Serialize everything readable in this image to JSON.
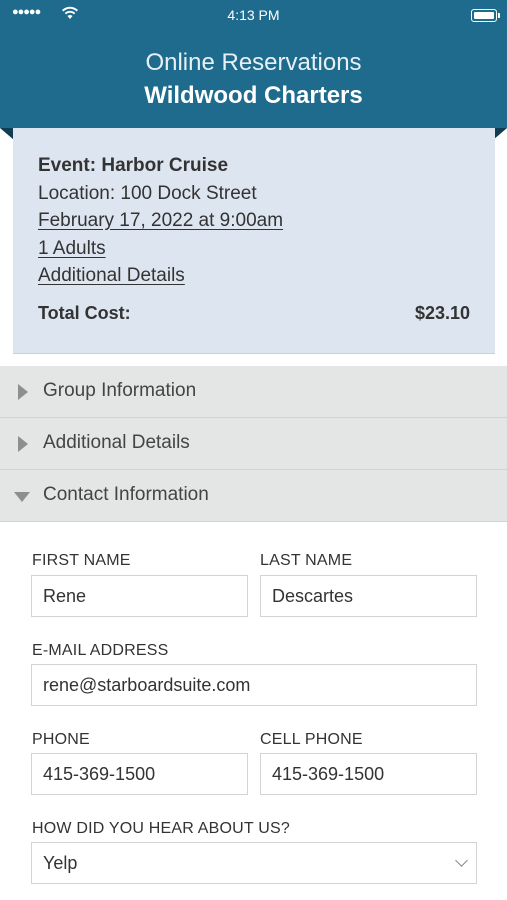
{
  "status_bar": {
    "time": "4:13 PM",
    "signal": "●●●●●"
  },
  "header": {
    "subtitle": "Online Reservations",
    "title": "Wildwood Charters"
  },
  "summary": {
    "event": "Event: Harbor Cruise",
    "location": "Location: 100 Dock Street",
    "date": "February 17, 2022 at 9:00am",
    "guests": "1 Adults",
    "details_link": "Additional Details",
    "total_label": "Total Cost:",
    "total_value": "$23.10"
  },
  "sections": [
    {
      "label": "Group Information",
      "expanded": false
    },
    {
      "label": "Additional Details",
      "expanded": false
    },
    {
      "label": "Contact Information",
      "expanded": true
    }
  ],
  "form": {
    "first_name": {
      "label": "FIRST NAME",
      "value": "Rene"
    },
    "last_name": {
      "label": "LAST NAME",
      "value": "Descartes"
    },
    "email": {
      "label": "E-MAIL ADDRESS",
      "value": "rene@starboardsuite.com"
    },
    "phone": {
      "label": "PHONE",
      "value": "415-369-1500"
    },
    "cell_phone": {
      "label": "CELL PHONE",
      "value": "415-369-1500"
    },
    "referral": {
      "label": "HOW DID YOU HEAR ABOUT US?",
      "value": "Yelp"
    }
  },
  "colors": {
    "header": "#1f6b8d",
    "summary_bg": "#dde6f0",
    "accordion_bg": "#e4e6e5"
  }
}
